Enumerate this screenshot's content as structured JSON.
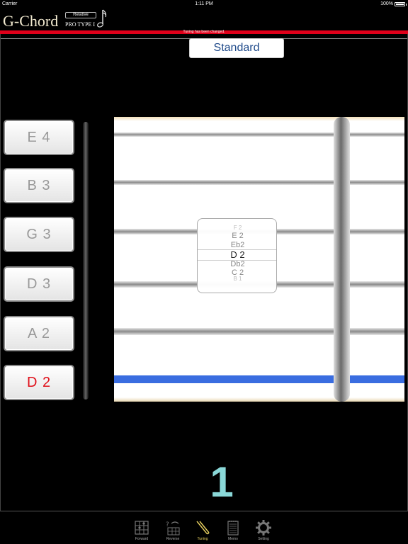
{
  "status_bar": {
    "carrier": "Carrier",
    "time": "1:11 PM",
    "battery": "100%"
  },
  "header": {
    "logo": "G-Chord",
    "relative_label": "Relative",
    "pro_type": "PRO TYPE I"
  },
  "banner": {
    "message": "Tuning has been changed."
  },
  "tuning_preset": {
    "label": "Standard"
  },
  "strings": [
    {
      "label": "E 4"
    },
    {
      "label": "B 3"
    },
    {
      "label": "G 3"
    },
    {
      "label": "D 3"
    },
    {
      "label": "A 2"
    },
    {
      "label": "D 2"
    }
  ],
  "selected_string": 5,
  "picker": {
    "options": [
      "F 2",
      "E 2",
      "Eb2",
      "D 2",
      "Db2",
      "C 2",
      "B 1"
    ],
    "selected": "D 2"
  },
  "fret_number": "1",
  "tabs": [
    {
      "label": "Forward"
    },
    {
      "label": "Reverse"
    },
    {
      "label": "Tuning"
    },
    {
      "label": "Memo"
    },
    {
      "label": "Setting"
    }
  ],
  "active_tab": "Tuning",
  "colors": {
    "banner": "#e0001a",
    "selected_note": "#e0101a",
    "active_string": "#3a6de0",
    "fret_number": "#8ad8d8",
    "active_tab": "#e8d060"
  }
}
